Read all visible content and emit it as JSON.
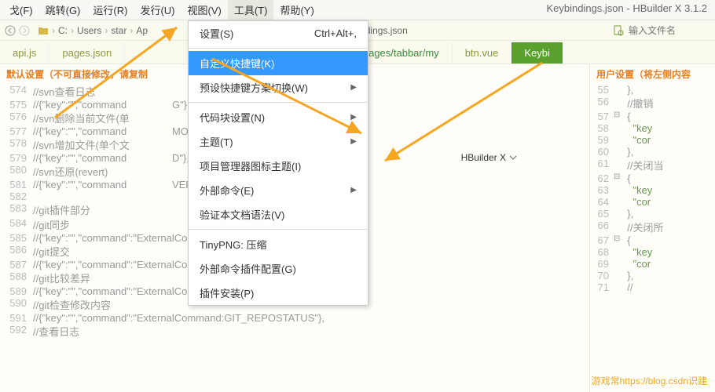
{
  "app_title": "Keybindings.json - HBuilder X 3.1.2",
  "menubar": [
    "戈(F)",
    "跳转(G)",
    "运行(R)",
    "发行(U)",
    "视图(V)",
    "工具(T)",
    "帮助(Y)"
  ],
  "menubar_active_index": 5,
  "breadcrumb": [
    "C:",
    "Users",
    "star",
    "Ap",
    "",
    "",
    "keybindings.json"
  ],
  "search_placeholder": "输入文件名",
  "tabs": [
    "api.js",
    "pages.json",
    "*my.vue | pages/tabbar/my",
    "btn.vue",
    "Keybi"
  ],
  "menu": {
    "items": [
      {
        "label": "设置(S)",
        "shortcut": "Ctrl+Alt+,"
      },
      {
        "sep": true
      },
      {
        "label": "自定义快捷键(K)",
        "highlighted": true
      },
      {
        "label": "预设快捷键方案切换(W)",
        "submenu": true
      },
      {
        "sep": true
      },
      {
        "label": "代码块设置(N)",
        "submenu": true
      },
      {
        "label": "主题(T)",
        "submenu": true
      },
      {
        "label": "项目管理器图标主题(I)"
      },
      {
        "label": "外部命令(E)",
        "submenu": true
      },
      {
        "label": "验证本文档语法(V)"
      },
      {
        "sep": true
      },
      {
        "label": "TinyPNG: 压缩"
      },
      {
        "label": "外部命令插件配置(G)"
      },
      {
        "label": "插件安装(P)"
      }
    ]
  },
  "left_pane": {
    "header": "默认设置（不可直接修改，请复制",
    "dropdown": "HBuilder X",
    "lines": [
      {
        "n": 574,
        "t": "//svn查看日志"
      },
      {
        "n": 575,
        "t": "//{\"key\":\"\",\"command                G\"},"
      },
      {
        "n": 576,
        "t": "//svn删除当前文件(单"
      },
      {
        "n": 577,
        "t": "//{\"key\":\"\",\"command                MOVE\"},"
      },
      {
        "n": 578,
        "t": "//svn增加文件(单个文"
      },
      {
        "n": 579,
        "t": "//{\"key\":\"\",\"command                D\"},"
      },
      {
        "n": 580,
        "t": "//svn还原(revert)"
      },
      {
        "n": 581,
        "t": "//{\"key\":\"\",\"command                VERT\"},"
      },
      {
        "n": 582,
        "t": ""
      },
      {
        "n": 583,
        "t": "//git插件部分"
      },
      {
        "n": 584,
        "t": "//git同步"
      },
      {
        "n": 585,
        "t": "//{\"key\":\"\",\"command\":\"ExternalCommand:GIT_SYNC\"},"
      },
      {
        "n": 586,
        "t": "//git提交"
      },
      {
        "n": 587,
        "t": "//{\"key\":\"\",\"command\":\"ExternalCommand:GIT_COMMIT\"},"
      },
      {
        "n": 588,
        "t": "//git比较差异"
      },
      {
        "n": 589,
        "t": "//{\"key\":\"\",\"command\":\"ExternalCommand:GIT_DIFF\"},"
      },
      {
        "n": 590,
        "t": "//git检查修改内容"
      },
      {
        "n": 591,
        "t": "//{\"key\":\"\",\"command\":\"ExternalCommand:GIT_REPOSTATUS\"},"
      },
      {
        "n": 592,
        "t": "//查看日志"
      }
    ]
  },
  "right_pane": {
    "header": "用户设置（将左侧内容",
    "lines": [
      {
        "n": 55,
        "f": "",
        "t": "  },"
      },
      {
        "n": 56,
        "f": "",
        "t": "  //撤销"
      },
      {
        "n": 57,
        "f": "⊟",
        "t": "  {"
      },
      {
        "n": 58,
        "f": "",
        "t": "    \"key"
      },
      {
        "n": 59,
        "f": "",
        "t": "    \"cor"
      },
      {
        "n": 60,
        "f": "",
        "t": "  },"
      },
      {
        "n": 61,
        "f": "",
        "t": "  //关闭当"
      },
      {
        "n": 62,
        "f": "⊟",
        "t": "  {"
      },
      {
        "n": 63,
        "f": "",
        "t": "    \"key"
      },
      {
        "n": 64,
        "f": "",
        "t": "    \"cor"
      },
      {
        "n": 65,
        "f": "",
        "t": "  },"
      },
      {
        "n": 66,
        "f": "",
        "t": "  //关闭所"
      },
      {
        "n": 67,
        "f": "⊟",
        "t": "  {"
      },
      {
        "n": 68,
        "f": "",
        "t": "    \"key"
      },
      {
        "n": 69,
        "f": "",
        "t": "    \"cor"
      },
      {
        "n": 70,
        "f": "",
        "t": "  },"
      },
      {
        "n": 71,
        "f": "",
        "t": "  //"
      }
    ]
  },
  "watermark": "游戏常https://blog.csdn识建"
}
